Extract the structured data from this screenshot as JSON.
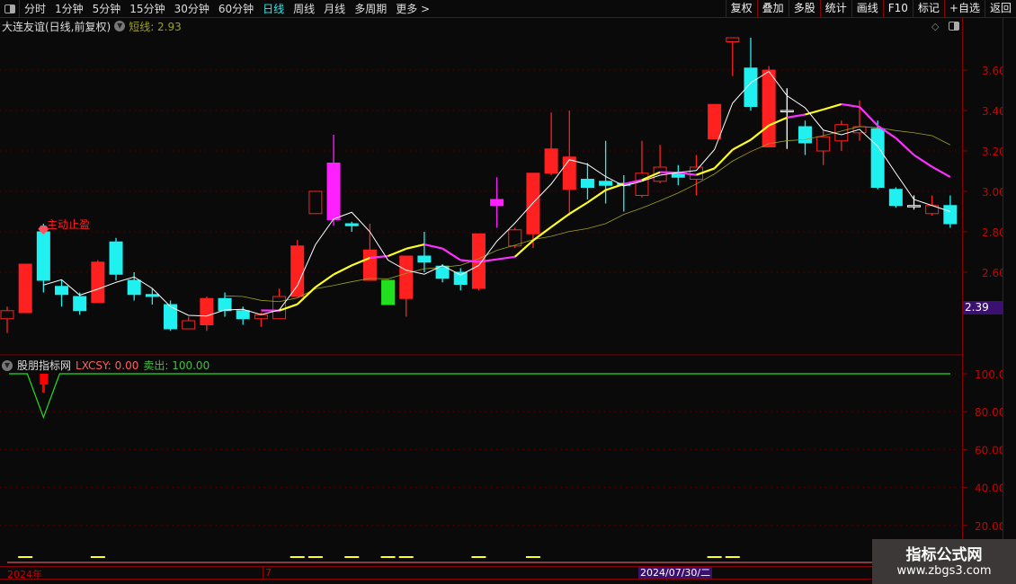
{
  "toolbar": {
    "periods": [
      "分时",
      "1分钟",
      "5分钟",
      "15分钟",
      "30分钟",
      "60分钟",
      "日线",
      "周线",
      "月线",
      "多周期",
      "更多 >"
    ],
    "active_period": "日线",
    "buttons": [
      "复权",
      "叠加",
      "多股",
      "统计",
      "画线",
      "F10",
      "标记",
      "+自选",
      "返回"
    ]
  },
  "main_title": {
    "stock": "大连友谊(日线,前复权)",
    "indicator": "短线: 2.93"
  },
  "signal_label": "主动止盈",
  "current_price_tag": "2.39",
  "sub_panel": {
    "name": "股朋指标网",
    "lxcsy": "LXCSY: 0.00",
    "sell": "卖出: 100.00"
  },
  "dates": {
    "year": "2024年",
    "month": "7",
    "cursor": "2024/07/30/二"
  },
  "watermark": {
    "name": "指标公式网",
    "url": "www.zbgs3.com"
  },
  "colors": {
    "up": "#ff2020",
    "down": "#20f0f0",
    "signal": "#ff20ff",
    "green": "#20e020",
    "ma_short": "#ffffff",
    "ma_mid_up": "#ffff20",
    "ma_mid": "#ff30ff",
    "ma_long": "#a0a020",
    "axis": "#cc0000"
  },
  "chart_data": {
    "type": "candlestick",
    "ylim": [
      2.2,
      3.78
    ],
    "yticks": [
      "3.60",
      "3.40",
      "3.20",
      "3.00",
      "2.80",
      "2.60"
    ],
    "candles": [
      {
        "o": 2.37,
        "c": 2.41,
        "h": 2.43,
        "l": 2.3
      },
      {
        "o": 2.4,
        "c": 2.64,
        "h": 2.64,
        "l": 2.4
      },
      {
        "o": 2.8,
        "c": 2.56,
        "h": 2.84,
        "l": 2.5
      },
      {
        "o": 2.53,
        "c": 2.49,
        "h": 2.56,
        "l": 2.43
      },
      {
        "o": 2.48,
        "c": 2.41,
        "h": 2.5,
        "l": 2.39
      },
      {
        "o": 2.45,
        "c": 2.65,
        "h": 2.66,
        "l": 2.45
      },
      {
        "o": 2.75,
        "c": 2.59,
        "h": 2.77,
        "l": 2.56
      },
      {
        "o": 2.56,
        "c": 2.49,
        "h": 2.6,
        "l": 2.46
      },
      {
        "o": 2.49,
        "c": 2.48,
        "h": 2.52,
        "l": 2.44
      },
      {
        "o": 2.44,
        "c": 2.32,
        "h": 2.46,
        "l": 2.31
      },
      {
        "o": 2.32,
        "c": 2.36,
        "h": 2.38,
        "l": 2.32
      },
      {
        "o": 2.34,
        "c": 2.47,
        "h": 2.48,
        "l": 2.31
      },
      {
        "o": 2.47,
        "c": 2.41,
        "h": 2.5,
        "l": 2.38
      },
      {
        "o": 2.41,
        "c": 2.37,
        "h": 2.43,
        "l": 2.34
      },
      {
        "o": 2.37,
        "c": 2.39,
        "h": 2.4,
        "l": 2.33
      },
      {
        "o": 2.37,
        "c": 2.48,
        "h": 2.52,
        "l": 2.37
      },
      {
        "o": 2.48,
        "c": 2.73,
        "h": 2.76,
        "l": 2.48
      },
      {
        "o": 2.89,
        "c": 3.0,
        "h": 3.0,
        "l": 2.89
      },
      {
        "o": 3.14,
        "c": 2.86,
        "h": 3.28,
        "l": 2.83,
        "signal": true
      },
      {
        "o": 2.84,
        "c": 2.83,
        "h": 2.85,
        "l": 2.8
      },
      {
        "o": 2.56,
        "c": 2.71,
        "h": 2.84,
        "l": 2.56
      },
      {
        "o": 2.56,
        "c": 2.44,
        "h": 2.56,
        "l": 2.44,
        "green": true
      },
      {
        "o": 2.47,
        "c": 2.68,
        "h": 2.68,
        "l": 2.38
      },
      {
        "o": 2.68,
        "c": 2.65,
        "h": 2.8,
        "l": 2.6
      },
      {
        "o": 2.63,
        "c": 2.57,
        "h": 2.64,
        "l": 2.55
      },
      {
        "o": 2.6,
        "c": 2.54,
        "h": 2.62,
        "l": 2.51
      },
      {
        "o": 2.52,
        "c": 2.79,
        "h": 2.79,
        "l": 2.51
      },
      {
        "o": 2.96,
        "c": 2.93,
        "h": 3.07,
        "l": 2.82,
        "signal": true
      },
      {
        "o": 2.73,
        "c": 2.81,
        "h": 2.82,
        "l": 2.72
      },
      {
        "o": 2.79,
        "c": 3.09,
        "h": 3.09,
        "l": 2.72
      },
      {
        "o": 3.09,
        "c": 3.21,
        "h": 3.39,
        "l": 3.08
      },
      {
        "o": 3.01,
        "c": 3.17,
        "h": 3.4,
        "l": 2.88
      },
      {
        "o": 3.06,
        "c": 3.02,
        "h": 3.14,
        "l": 2.96
      },
      {
        "o": 3.05,
        "c": 3.03,
        "h": 3.25,
        "l": 2.94
      },
      {
        "o": 3.04,
        "c": 3.03,
        "h": 3.08,
        "l": 2.9
      },
      {
        "o": 2.98,
        "c": 3.09,
        "h": 3.25,
        "l": 2.97
      },
      {
        "o": 3.05,
        "c": 3.12,
        "h": 3.23,
        "l": 3.04
      },
      {
        "o": 3.09,
        "c": 3.07,
        "h": 3.13,
        "l": 3.03
      },
      {
        "o": 3.06,
        "c": 3.12,
        "h": 3.18,
        "l": 2.98
      },
      {
        "o": 3.26,
        "c": 3.43,
        "h": 3.43,
        "l": 3.26
      },
      {
        "o": 3.74,
        "c": 3.76,
        "h": 3.76,
        "l": 3.57
      },
      {
        "o": 3.61,
        "c": 3.42,
        "h": 3.76,
        "l": 3.4
      },
      {
        "o": 3.22,
        "c": 3.6,
        "h": 3.62,
        "l": 3.22
      },
      {
        "o": 3.4,
        "c": 3.4,
        "h": 3.51,
        "l": 3.21
      },
      {
        "o": 3.32,
        "c": 3.24,
        "h": 3.35,
        "l": 3.18
      },
      {
        "o": 3.2,
        "c": 3.27,
        "h": 3.3,
        "l": 3.13
      },
      {
        "o": 3.25,
        "c": 3.33,
        "h": 3.35,
        "l": 3.2
      },
      {
        "o": 3.29,
        "c": 3.32,
        "h": 3.45,
        "l": 3.25
      },
      {
        "o": 3.31,
        "c": 3.02,
        "h": 3.35,
        "l": 3.01
      },
      {
        "o": 3.01,
        "c": 2.93,
        "h": 3.02,
        "l": 2.92
      },
      {
        "o": 2.93,
        "c": 2.93,
        "h": 2.98,
        "l": 2.91
      },
      {
        "o": 2.89,
        "c": 2.93,
        "h": 2.98,
        "l": 2.88
      },
      {
        "o": 2.93,
        "c": 2.84,
        "h": 2.98,
        "l": 2.82
      }
    ],
    "sub": {
      "ylim": [
        10,
        105
      ],
      "yticks": [
        "100.0",
        "80.00",
        "60.00",
        "40.00",
        "20.00"
      ],
      "sell_line_min": 77,
      "sell_line_min_index": 2,
      "lxcsy_bar_index": 2
    }
  }
}
